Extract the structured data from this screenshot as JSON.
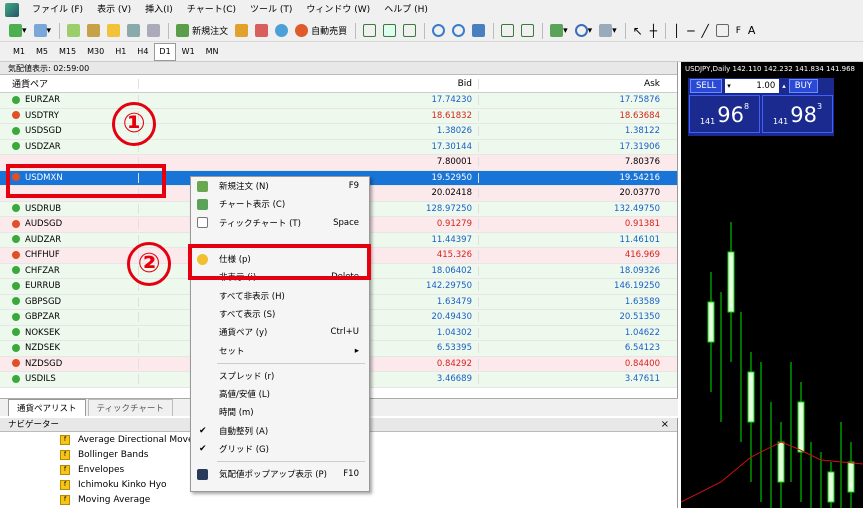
{
  "menu": [
    "ファイル (F)",
    "表示 (V)",
    "挿入(I)",
    "チャート(C)",
    "ツール (T)",
    "ウィンドウ (W)",
    "ヘルプ (H)"
  ],
  "toolbar": {
    "new_order": "新規注文",
    "auto_trade": "自動売買"
  },
  "timeframes": [
    "M1",
    "M5",
    "M15",
    "M30",
    "H1",
    "H4",
    "D1",
    "W1",
    "MN"
  ],
  "market_watch": {
    "title": "気配値表示: 02:59:00",
    "headers": {
      "symbol": "通貨ペア",
      "bid": "Bid",
      "ask": "Ask"
    },
    "rows": [
      {
        "symbol": "EURZAR",
        "bid": "17.74230",
        "ask": "17.75876",
        "dir": "up",
        "bg": "green"
      },
      {
        "symbol": "USDTRY",
        "bid": "18.61832",
        "ask": "18.63684",
        "dir": "down",
        "bg": "green"
      },
      {
        "symbol": "USDSGD",
        "bid": "1.38026",
        "ask": "1.38122",
        "dir": "up",
        "bg": "green"
      },
      {
        "symbol": "USDZAR",
        "bid": "17.30144",
        "ask": "17.31906",
        "dir": "up",
        "bg": "green"
      },
      {
        "symbol": "",
        "bid": "7.80001",
        "ask": "7.80376",
        "dir": "",
        "bg": "pink"
      },
      {
        "symbol": "USDMXN",
        "bid": "19.52950",
        "ask": "19.54216",
        "dir": "down",
        "bg": "selected"
      },
      {
        "symbol": "",
        "bid": "20.02418",
        "ask": "20.03770",
        "dir": "",
        "bg": "pink"
      },
      {
        "symbol": "USDRUB",
        "bid": "128.97250",
        "ask": "132.49750",
        "dir": "up",
        "bg": "green"
      },
      {
        "symbol": "AUDSGD",
        "bid": "0.91279",
        "ask": "0.91381",
        "dir": "down",
        "bg": "pink"
      },
      {
        "symbol": "AUDZAR",
        "bid": "11.44397",
        "ask": "11.46101",
        "dir": "up",
        "bg": "green"
      },
      {
        "symbol": "CHFHUF",
        "bid": "415.326",
        "ask": "416.969",
        "dir": "down",
        "bg": "pink"
      },
      {
        "symbol": "CHFZAR",
        "bid": "18.06402",
        "ask": "18.09326",
        "dir": "up",
        "bg": "green"
      },
      {
        "symbol": "EURRUB",
        "bid": "142.29750",
        "ask": "146.19250",
        "dir": "up",
        "bg": "green"
      },
      {
        "symbol": "GBPSGD",
        "bid": "1.63479",
        "ask": "1.63589",
        "dir": "up",
        "bg": "green"
      },
      {
        "symbol": "GBPZAR",
        "bid": "20.49430",
        "ask": "20.51350",
        "dir": "up",
        "bg": "green"
      },
      {
        "symbol": "NOKSEK",
        "bid": "1.04302",
        "ask": "1.04622",
        "dir": "up",
        "bg": "green"
      },
      {
        "symbol": "NZDSEK",
        "bid": "6.53395",
        "ask": "6.54123",
        "dir": "up",
        "bg": "green"
      },
      {
        "symbol": "NZDSGD",
        "bid": "0.84292",
        "ask": "0.84400",
        "dir": "down",
        "bg": "pink"
      },
      {
        "symbol": "USDILS",
        "bid": "3.46689",
        "ask": "3.47611",
        "dir": "up",
        "bg": "green"
      }
    ]
  },
  "mw_tabs": [
    "通貨ペアリスト",
    "ティックチャート"
  ],
  "navigator": {
    "title": "ナビゲーター",
    "items": [
      "Average Directional Movem",
      "Bollinger Bands",
      "Envelopes",
      "Ichimoku Kinko Hyo",
      "Moving Average"
    ]
  },
  "chart": {
    "title": "USDJPY,Daily  142.110 142.232 141.834 141.968",
    "sell_label": "SELL",
    "buy_label": "BUY",
    "lot": "1.00",
    "sell_small": "141",
    "sell_big": "96",
    "sell_sup": "8",
    "buy_small": "141",
    "buy_big": "98",
    "buy_sup": "3"
  },
  "context_menu": [
    {
      "label": "新規注文 (N)",
      "shortcut": "F9"
    },
    {
      "label": "チャート表示 (C)",
      "shortcut": ""
    },
    {
      "label": "ティックチャート (T)",
      "shortcut": "Space"
    },
    {
      "label": "仕様 (p)",
      "shortcut": ""
    },
    {
      "label": "非表示 (i)",
      "shortcut": "Delete"
    },
    {
      "label": "すべて非表示 (H)",
      "shortcut": ""
    },
    {
      "label": "すべて表示 (S)",
      "shortcut": ""
    },
    {
      "label": "通貨ペア (y)",
      "shortcut": "Ctrl+U"
    },
    {
      "label": "セット",
      "shortcut": "▸"
    },
    {
      "label": "スプレッド (r)",
      "shortcut": ""
    },
    {
      "label": "高値/安値 (L)",
      "shortcut": ""
    },
    {
      "label": "時間 (m)",
      "shortcut": ""
    },
    {
      "label": "自動整列 (A)",
      "shortcut": ""
    },
    {
      "label": "グリッド (G)",
      "shortcut": ""
    },
    {
      "label": "気配値ポップアップ表示 (P)",
      "shortcut": "F10"
    }
  ],
  "annotations": {
    "one": "①",
    "two": "②"
  }
}
